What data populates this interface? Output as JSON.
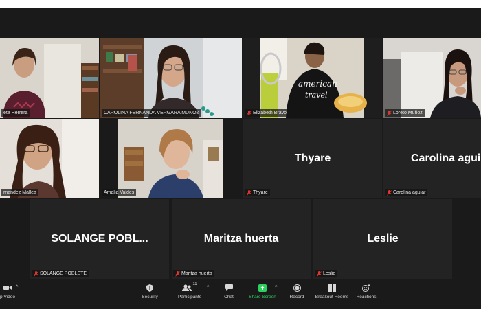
{
  "participants": [
    {
      "id": "p1",
      "tag": "eta Herrera",
      "muted": false,
      "video": true
    },
    {
      "id": "p2",
      "tag": "CAROLINA FERNANDA VERGARA MUNOZ",
      "muted": false,
      "video": true,
      "active_speaker": true
    },
    {
      "id": "p3",
      "tag": "Elizabeth Bravo",
      "muted": true,
      "video": true
    },
    {
      "id": "p4",
      "tag": "Loreto Muñoz",
      "muted": true,
      "video": true
    },
    {
      "id": "p5",
      "tag": "rnandez Mallea",
      "muted": false,
      "video": true
    },
    {
      "id": "p6",
      "tag": "Amalia Valdes",
      "muted": false,
      "video": true
    },
    {
      "id": "p7",
      "big": "Thyare",
      "tag": "Thyare",
      "muted": true,
      "video": false
    },
    {
      "id": "p8",
      "big": "Carolina agui",
      "tag": "Carolina aguiar",
      "muted": true,
      "video": false
    },
    {
      "id": "p9",
      "big": "SOLANGE  POBL...",
      "tag": "SOLANGE POBLETE",
      "muted": true,
      "video": false
    },
    {
      "id": "p10",
      "big": "Maritza huerta",
      "tag": "Maritza huerta",
      "muted": true,
      "video": false
    },
    {
      "id": "p11",
      "big": "Leslie",
      "tag": "Leslie",
      "muted": true,
      "video": false
    }
  ],
  "toolbar": {
    "stop_video": "p Video",
    "security": "Security",
    "participants": "Participants",
    "participants_count": "11",
    "chat": "Chat",
    "share_screen": "Share Screen",
    "record": "Record",
    "breakout_rooms": "Breakout Rooms",
    "reactions": "Reactions"
  },
  "colors": {
    "background": "#1a1a1a",
    "tile": "#232323",
    "active_speaker_border": "#c8e05a",
    "share_green": "#2bd15d",
    "mic_muted_red": "#e0372e"
  }
}
